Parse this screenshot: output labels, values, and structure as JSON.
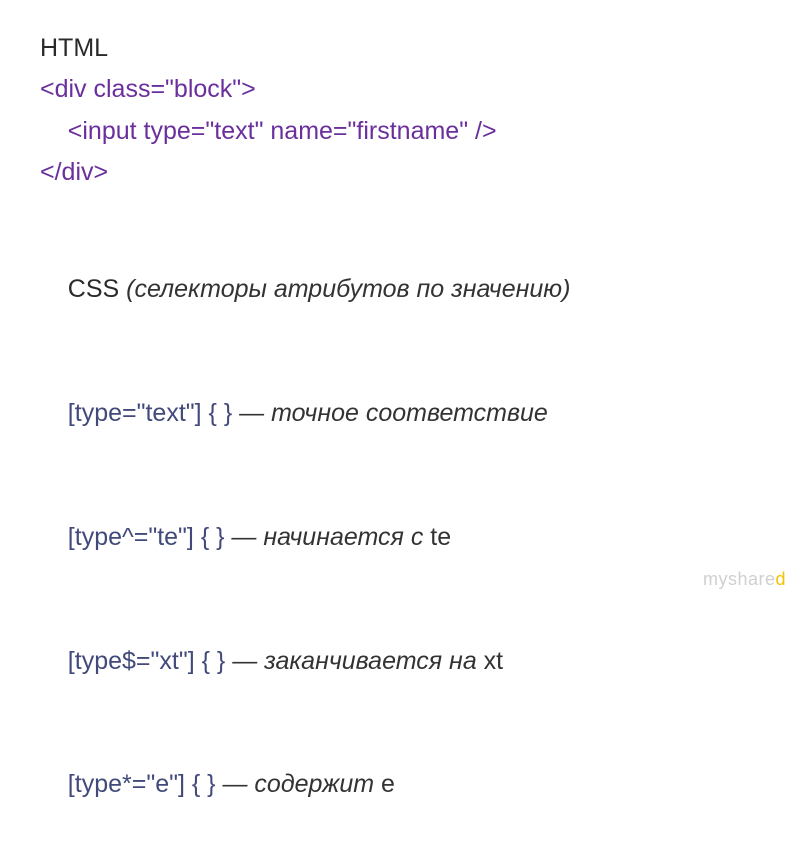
{
  "lines": {
    "l1": "HTML",
    "l2": "<div class=\"block\">",
    "l3": "    <input type=\"text\" name=\"firstname\" />",
    "l4": "</div>",
    "l5_prefix": "CSS ",
    "l5_italic": "(селекторы атрибутов по значению)",
    "l6_sel": "[type=\"text\"] { } ",
    "l6_desc": "— точное соответствие",
    "l7_sel": "[type^=\"te\"] { } ",
    "l7_desc_a": "— начинается с ",
    "l7_desc_b": "te",
    "l8_sel": "[type$=\"xt\"] { } ",
    "l8_desc_a": "— заканчивается на ",
    "l8_desc_b": "xt",
    "l9_sel": "[type*=\"e\"] { } ",
    "l9_desc_a": "— содержит ",
    "l9_desc_b": "e"
  },
  "watermark": {
    "left": "myshare",
    "right": "d"
  }
}
